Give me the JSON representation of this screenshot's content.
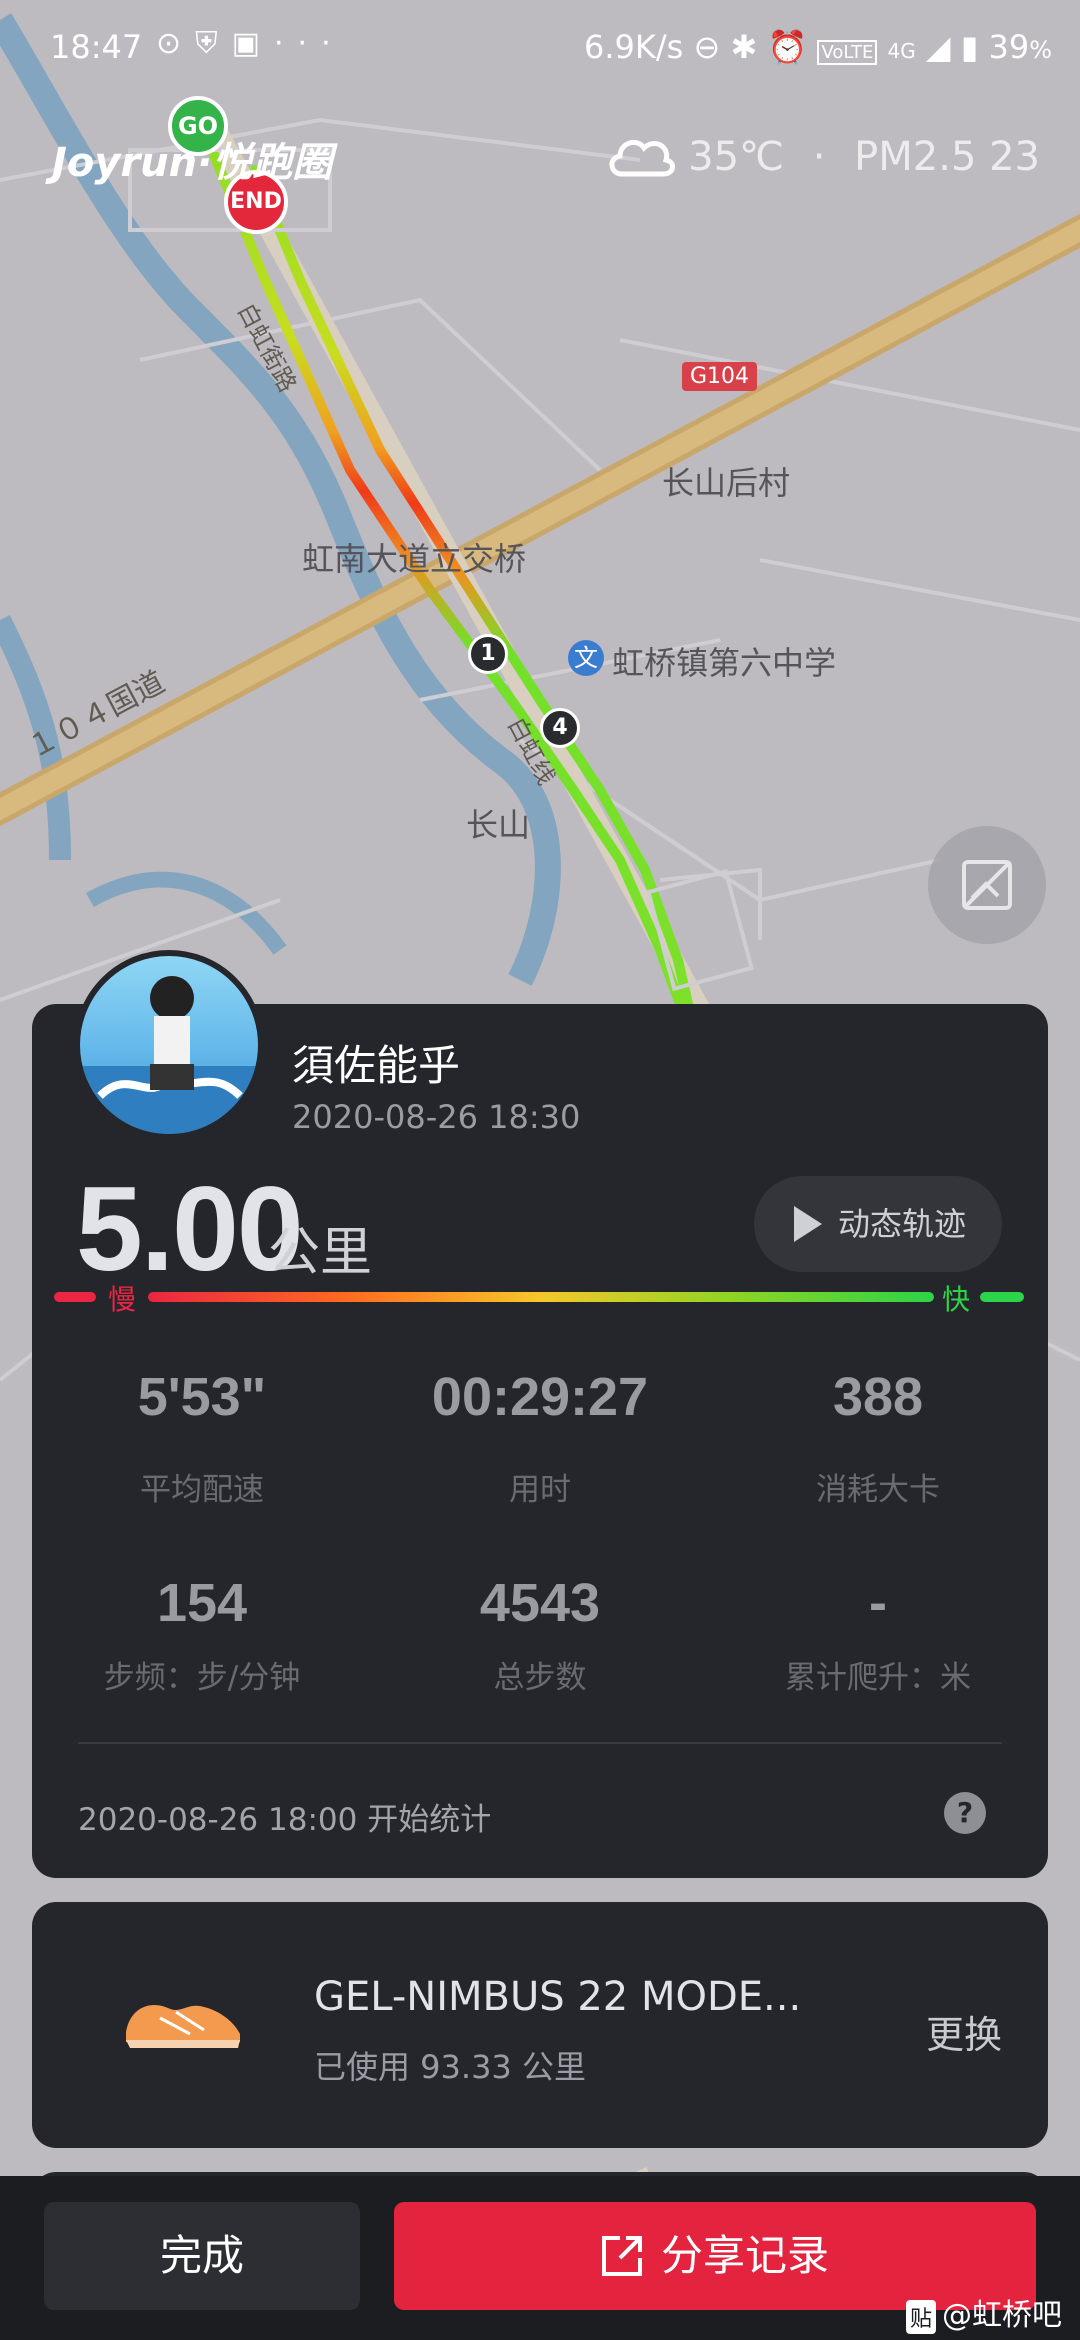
{
  "status_bar": {
    "time": "18:47",
    "speed": "6.9K/s",
    "network": "4G",
    "battery": "39",
    "battery_unit": "%",
    "icons": [
      "sync-icon",
      "shield-icon",
      "message-icon",
      "more-icon",
      "dnd-icon",
      "bluetooth-icon",
      "alarm-icon",
      "volte-icon",
      "signal-icon",
      "battery-icon"
    ]
  },
  "header": {
    "brand": "Joyrun·悦跑圈",
    "temperature": "35℃",
    "separator": "·",
    "air_quality": "PM2.5 23"
  },
  "map": {
    "labels": {
      "village": "长山后村",
      "interchange": "虹南大道立交桥",
      "school": "虹桥镇第六中学",
      "changshan": "长山",
      "national_road": "１０４国道",
      "road_a": "白虹街路",
      "road_b": "白虹线"
    },
    "road_badge": "G104",
    "poi_badge": "文",
    "start_label": "GO",
    "end_label": "END",
    "km_markers": [
      "1",
      "4"
    ]
  },
  "run": {
    "username": "須佐能乎",
    "datetime": "2020-08-26 18:30",
    "distance": "5.00",
    "distance_unit": "公里",
    "track_button": "动态轨迹",
    "slow_label": "慢",
    "fast_label": "快",
    "stats": [
      {
        "value": "5'53\"",
        "label": "平均配速"
      },
      {
        "value": "00:29:27",
        "label": "用时"
      },
      {
        "value": "388",
        "label": "消耗大卡"
      },
      {
        "value": "154",
        "label": "步频：步/分钟"
      },
      {
        "value": "4543",
        "label": "总步数"
      },
      {
        "value": "-",
        "label": "累计爬升：米"
      }
    ],
    "start_stat": "2020-08-26 18:00  开始统计",
    "help": "?"
  },
  "shoe": {
    "name": "GEL-NIMBUS 22 MODE...",
    "used": "已使用 93.33 公里",
    "swap": "更换"
  },
  "actions": {
    "done": "完成",
    "share": "分享记录"
  },
  "watermark": {
    "tie": "贴",
    "text": "@虹桥吧"
  },
  "colors": {
    "card_bg": "#25262b",
    "share_red": "#e4233f",
    "slow_red": "#ea2642",
    "fast_green": "#2bd448"
  }
}
